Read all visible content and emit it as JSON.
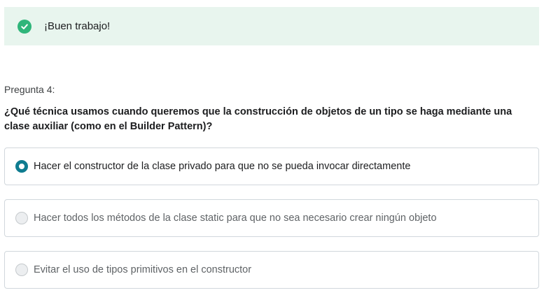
{
  "feedback": {
    "icon": "check-circle-icon",
    "text": "¡Buen trabajo!",
    "color": "#2fb57a",
    "background": "#e8f5ee"
  },
  "question": {
    "number_label": "Pregunta 4:",
    "text": "¿Qué técnica usamos cuando queremos que la construcción de objetos de un tipo se haga mediante una clase auxiliar (como en el Builder Pattern)?"
  },
  "options": [
    {
      "label": "Hacer el constructor de la clase privado para que no se pueda invocar directamente",
      "selected": true
    },
    {
      "label": "Hacer todos los métodos de la clase static para que no sea necesario crear ningún objeto",
      "selected": false
    },
    {
      "label": "Evitar el uso de tipos primitivos en el constructor",
      "selected": false
    }
  ],
  "colors": {
    "selected_radio": "#0f7c90",
    "border": "#d1d7dc"
  }
}
